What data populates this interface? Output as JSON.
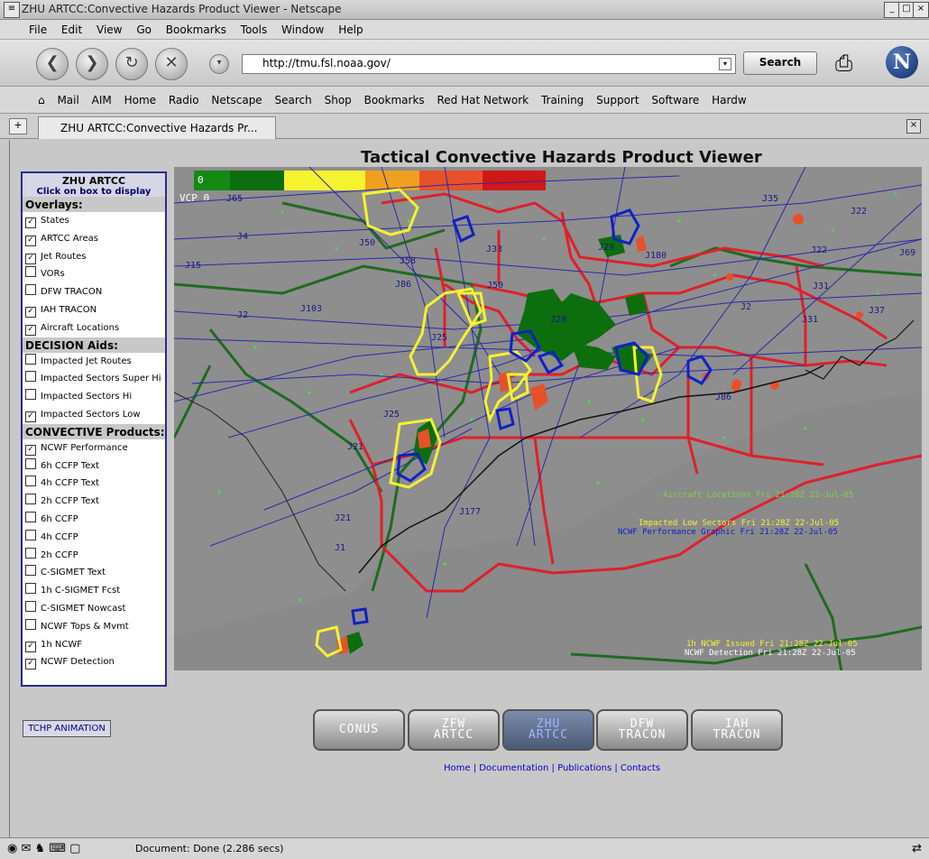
{
  "window": {
    "title": "ZHU ARTCC:Convective Hazards Product Viewer - Netscape"
  },
  "menu": [
    "File",
    "Edit",
    "View",
    "Go",
    "Bookmarks",
    "Tools",
    "Window",
    "Help"
  ],
  "navigation": {
    "url": "http://tmu.fsl.noaa.gov/",
    "search_label": "Search",
    "logo_letter": "N"
  },
  "personal_toolbar": [
    "Mail",
    "AIM",
    "Home",
    "Radio",
    "Netscape",
    "Search",
    "Shop",
    "Bookmarks",
    "Red Hat Network",
    "Training",
    "Support",
    "Software",
    "Hardw"
  ],
  "tab": {
    "label": "ZHU ARTCC:Convective Hazards Pr..."
  },
  "page": {
    "title": "Tactical Convective Hazards Product Viewer"
  },
  "panel": {
    "header": "ZHU ARTCC",
    "subheader": "Click on box to display",
    "sections": [
      {
        "title": "Overlays:",
        "items": [
          {
            "label": "States",
            "checked": true
          },
          {
            "label": "ARTCC Areas",
            "checked": true
          },
          {
            "label": "Jet Routes",
            "checked": true
          },
          {
            "label": "VORs",
            "checked": false
          },
          {
            "label": "DFW TRACON",
            "checked": false
          },
          {
            "label": "IAH TRACON",
            "checked": true
          },
          {
            "label": "Aircraft Locations",
            "checked": true
          }
        ]
      },
      {
        "title": "DECISION Aids:",
        "items": [
          {
            "label": "Impacted Jet Routes",
            "checked": false
          },
          {
            "label": "Impacted Sectors Super Hi",
            "checked": false
          },
          {
            "label": "Impacted Sectors Hi",
            "checked": false
          },
          {
            "label": "Impacted Sectors Low",
            "checked": true
          }
        ]
      },
      {
        "title": "CONVECTIVE Products:",
        "items": [
          {
            "label": "NCWF Performance",
            "checked": true
          },
          {
            "label": "6h CCFP Text",
            "checked": false
          },
          {
            "label": "4h CCFP Text",
            "checked": false
          },
          {
            "label": "2h CCFP Text",
            "checked": false
          },
          {
            "label": "6h CCFP",
            "checked": false
          },
          {
            "label": "4h CCFP",
            "checked": false
          },
          {
            "label": "2h CCFP",
            "checked": false
          },
          {
            "label": "C-SIGMET Text",
            "checked": false
          },
          {
            "label": "1h C-SIGMET Fcst",
            "checked": false
          },
          {
            "label": "C-SIGMET Nowcast",
            "checked": false
          },
          {
            "label": "NCWF Tops & Mvmt",
            "checked": false
          },
          {
            "label": "1h NCWF",
            "checked": true
          },
          {
            "label": "NCWF Detection",
            "checked": true
          }
        ]
      }
    ]
  },
  "map": {
    "vcp": "VCP 0",
    "scale_zero": "0",
    "route_labels": [
      "J65",
      "J4",
      "J50",
      "J33",
      "J29",
      "J180",
      "J35",
      "J22",
      "J22",
      "J69",
      "J15",
      "J2",
      "J58",
      "J86",
      "J103",
      "J50",
      "J28",
      "J31",
      "J2",
      "J31",
      "J37",
      "J25",
      "J86",
      "J25",
      "J21",
      "J177",
      "J21",
      "J1"
    ],
    "annotations": {
      "aircraft": "Aircraft Locations Fri 21:28Z 22-Jul-05",
      "impacted_low": "Impacted Low Sectors  Fri 21:28Z 22-Jul-05",
      "ncwf_perf": "NCWF Performance Graphic Fri 21:28Z 22-Jul-05",
      "ncwf_issued": "1h NCWF Issued Fri 21:28Z 22-Jul-05",
      "ncwf_detect": "NCWF Detection Fri 21:28Z 22-Jul-05"
    }
  },
  "animation_button": "TCHP ANIMATION",
  "region_buttons": [
    "CONUS",
    "ZFW\nARTCC",
    "ZHU\nARTCC",
    "DFW\nTRACON",
    "IAH\nTRACON"
  ],
  "footer_links": [
    "Home",
    "Documentation",
    "Publications",
    "Contacts"
  ],
  "status": {
    "text": "Document: Done (2.286 secs)"
  },
  "colors": {
    "map_bg": "#8e8e8e",
    "sector_red": "#e0202a",
    "route_blue": "#2a2aa8",
    "artcc_green": "#1f6b1f",
    "ncwf_yellow": "#f5f230",
    "ncwf_blue": "#1020c8"
  }
}
